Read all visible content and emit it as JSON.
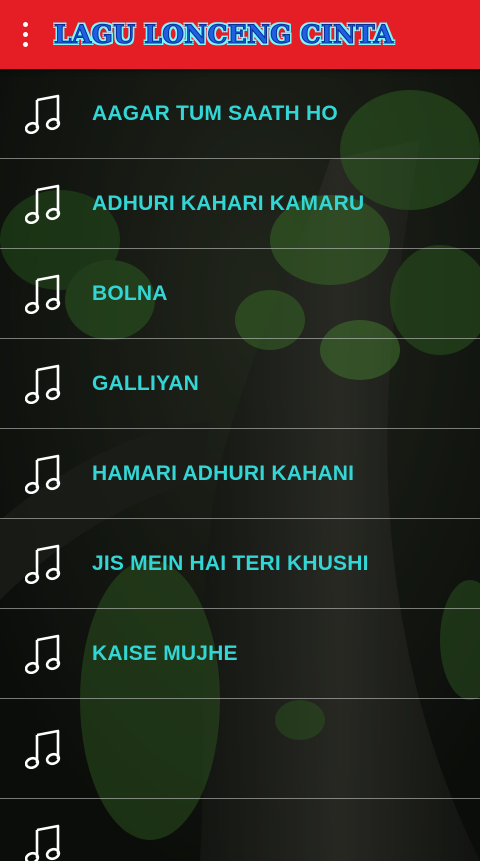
{
  "app": {
    "title": "LAGU LONCENG CINTA"
  },
  "toolbar": {
    "background": "#e51d24",
    "menu_icon": "overflow-menu-icon"
  },
  "songs": [
    {
      "title": "AAGAR TUM SAATH HO",
      "icon": "music-note-icon"
    },
    {
      "title": "ADHURI KAHARI KAMARU",
      "icon": "music-note-icon"
    },
    {
      "title": "BOLNA",
      "icon": "music-note-icon"
    },
    {
      "title": "GALLIYAN",
      "icon": "music-note-icon"
    },
    {
      "title": "HAMARI ADHURI KAHANI",
      "icon": "music-note-icon"
    },
    {
      "title": "JIS MEIN HAI TERI KHUSHI",
      "icon": "music-note-icon"
    },
    {
      "title": "KAISE MUJHE",
      "icon": "music-note-icon"
    },
    {
      "title": "",
      "icon": "music-note-icon"
    },
    {
      "title": "",
      "icon": "music-note-icon"
    }
  ],
  "colors": {
    "accent": "#e51d24",
    "song_text": "#33d6d4",
    "title_fill": "#1f5fe0",
    "title_outline": "#7ff5ff"
  }
}
